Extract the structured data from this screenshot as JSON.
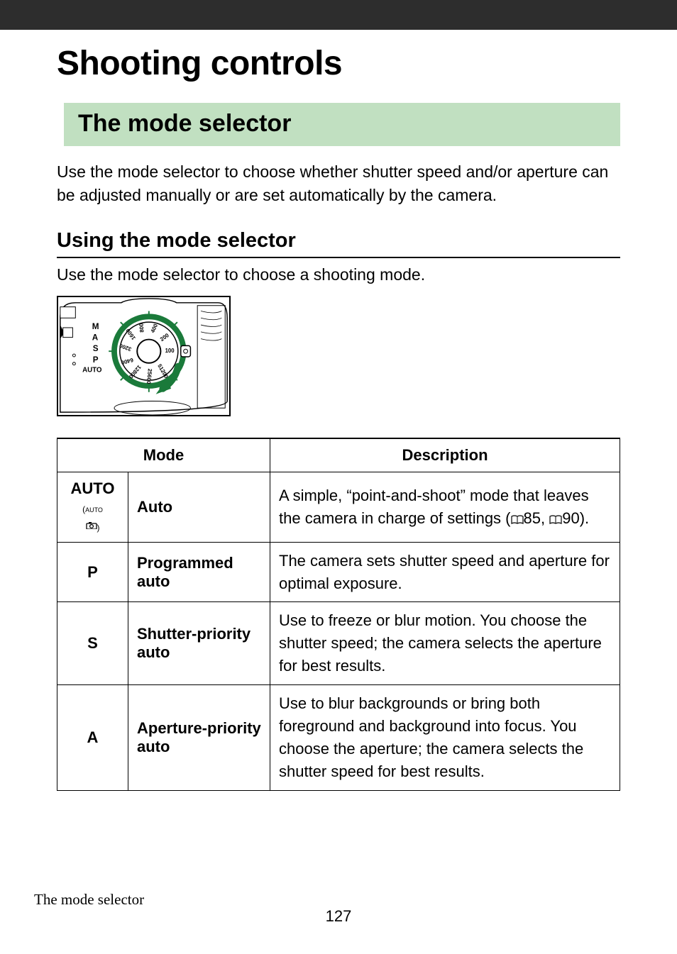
{
  "chapter": {
    "title": "Shooting controls"
  },
  "section": {
    "title": "The mode selector"
  },
  "intro": "Use the mode selector to choose whether shutter speed and/or aperture can be adjusted manually or are set automatically by the camera.",
  "subhead": "Using the mode selector",
  "sub_para": "Use the mode selector to choose a shooting mode.",
  "table": {
    "headers": {
      "mode": "Mode",
      "desc": "Description"
    },
    "rows": [
      {
        "symbol": "AUTO",
        "symbol_sub": "(AUTO / camera-icon)",
        "name": "Auto",
        "desc_pre": "A simple, “point-and-shoot” mode that leaves the camera in charge of settings (",
        "ref1": "85",
        "mid": ", ",
        "ref2": "90",
        "desc_post": ")."
      },
      {
        "symbol": "P",
        "name": "Programmed auto",
        "desc": "The camera sets shutter speed and aperture for optimal exposure."
      },
      {
        "symbol": "S",
        "name": "Shutter-priority auto",
        "desc": "Use to freeze or blur motion. You choose the shutter speed; the camera selects the aperture for best results."
      },
      {
        "symbol": "A",
        "name": "Aperture-priority auto",
        "desc": "Use to blur backgrounds or bring both foreground and background into focus. You choose the aperture; the camera selects the shutter speed for best results."
      }
    ]
  },
  "diagram": {
    "mode_labels": [
      "M",
      "A",
      "S",
      "P",
      "AUTO"
    ],
    "iso_values": [
      "100",
      "200",
      "400",
      "800",
      "1600",
      "3200",
      "6400",
      "12800",
      "25600",
      "51200"
    ]
  },
  "footer": {
    "label": "The mode selector",
    "page": "127"
  }
}
